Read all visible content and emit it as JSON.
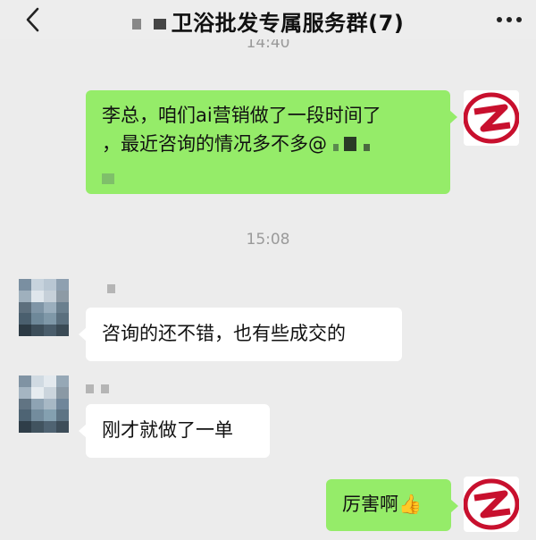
{
  "header": {
    "title": "卫浴批发专属服务群(7)"
  },
  "messages": [
    {
      "time": "14:40",
      "sender": "self",
      "text_line1": "李总，咱们ai营销做了一段时间了",
      "text_line2": "，最近咨询的情况多不多@"
    },
    {
      "time": "15:08",
      "sender": "other",
      "text": "咨询的还不错，也有些成交的"
    },
    {
      "sender": "other",
      "text": "刚才就做了一单"
    },
    {
      "sender": "self",
      "text": "厉害啊",
      "emoji": "👍"
    }
  ],
  "colors": {
    "chat_background": "#ececec",
    "self_bubble": "#95ec69",
    "other_bubble": "#ffffff",
    "logo_red": "#c8102e"
  },
  "icons": {
    "back": "chevron-left-icon",
    "more": "more-dots-icon",
    "self_avatar": "company-logo-avatar",
    "emoji": "thumbs-up-emoji"
  }
}
